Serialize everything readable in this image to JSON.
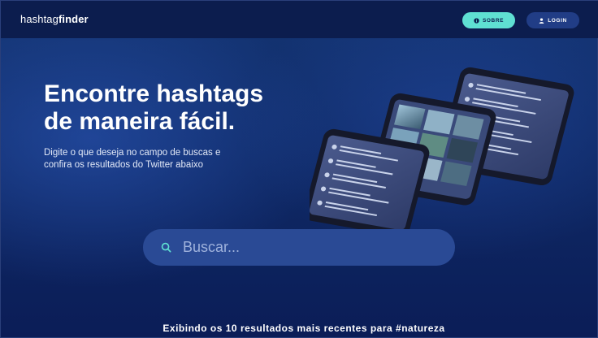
{
  "header": {
    "logo_regular": "hashtag",
    "logo_bold": "finder",
    "sobre_label": "SOBRE",
    "login_label": "LOGIN"
  },
  "hero": {
    "title_line1": "Encontre hashtags",
    "title_line2": "de maneira fácil.",
    "subtitle_line1": "Digite o que deseja no campo de buscas e",
    "subtitle_line2": "confira os resultados do Twitter abaixo"
  },
  "search": {
    "placeholder": "Buscar...",
    "value": ""
  },
  "results": {
    "text": "Exibindo os 10 resultados mais recentes para #natureza"
  },
  "colors": {
    "accent": "#5fe0d2",
    "header_bg": "#0c1d4e",
    "login_bg": "#213d86",
    "search_bg": "#2a4a95"
  },
  "icons": {
    "sobre": "info-icon",
    "login": "user-icon",
    "search": "search-icon"
  }
}
